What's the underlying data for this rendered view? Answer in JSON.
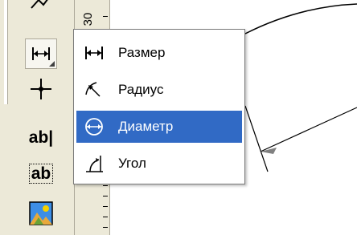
{
  "ruler": {
    "label": "30"
  },
  "toolbar": {
    "items": [
      {
        "name": "line-tool",
        "text": ""
      },
      {
        "name": "dimension-tool",
        "text": ""
      },
      {
        "name": "point-tool",
        "text": ""
      },
      {
        "name": "text-tool",
        "text": "ab|"
      },
      {
        "name": "text-box-tool",
        "text": "ab"
      },
      {
        "name": "picture-tool",
        "text": ""
      }
    ]
  },
  "menu": {
    "items": [
      {
        "label": "Размер",
        "icon": "linear-dimension-icon",
        "selected": false
      },
      {
        "label": "Радиус",
        "icon": "radius-dimension-icon",
        "selected": false
      },
      {
        "label": "Диаметр",
        "icon": "diameter-dimension-icon",
        "selected": true
      },
      {
        "label": "Угол",
        "icon": "angle-dimension-icon",
        "selected": false
      }
    ]
  },
  "colors": {
    "selection": "#316ac5",
    "toolbar_bg": "#ece9d8",
    "menu_border": "#7a7a7a"
  }
}
